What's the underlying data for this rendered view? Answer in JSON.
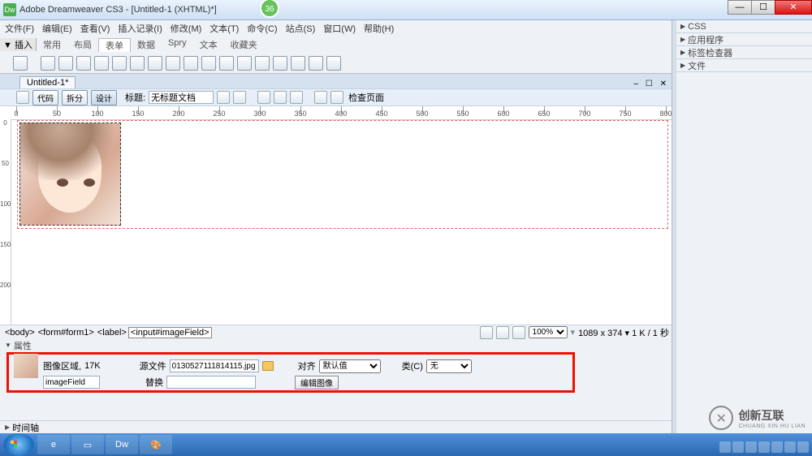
{
  "window": {
    "title": "Adobe Dreamweaver CS3 - [Untitled-1 (XHTML)*]",
    "badge": "36"
  },
  "menus": [
    "文件(F)",
    "编辑(E)",
    "查看(V)",
    "插入记录(I)",
    "修改(M)",
    "文本(T)",
    "命令(C)",
    "站点(S)",
    "窗口(W)",
    "帮助(H)"
  ],
  "insert": {
    "lead": "▼ 插入",
    "tabs": [
      "常用",
      "布局",
      "表单",
      "数据",
      "Spry",
      "文本",
      "收藏夹"
    ],
    "active_index": 2
  },
  "doc_tab": "Untitled-1*",
  "doc_winops": "– ☐ ✕",
  "doc_toolbar": {
    "code_btn": "代码",
    "split_btn": "拆分",
    "design_btn": "设计",
    "title_label": "标题:",
    "title_value": "无标题文档",
    "check_page": "检查页面"
  },
  "ruler_ticks": [
    0,
    50,
    100,
    150,
    200,
    250,
    300,
    350,
    400,
    450,
    500,
    550,
    600,
    650,
    700,
    750,
    800
  ],
  "vruler_ticks": [
    0,
    50,
    100,
    150,
    200
  ],
  "status": {
    "path": [
      "<body>",
      "<form#form1>",
      "<label>",
      "<input#imageField>"
    ],
    "zoom": "100%",
    "dims": "1089 x 374 ▾ 1 K / 1 秒"
  },
  "properties": {
    "header": "属性",
    "region_label": "图像区域,",
    "size": "17K",
    "name_value": "imageField",
    "src_label": "源文件",
    "src_value": "0130527111814115.jpg",
    "alt_label": "替换",
    "alt_value": "",
    "align_label": "对齐",
    "align_value": "默认值",
    "edit_btn": "编辑图像",
    "class_label": "类(C)",
    "class_value": "无"
  },
  "timeline": "时间轴",
  "right_panels": [
    "CSS",
    "应用程序",
    "标签检查器",
    "文件"
  ],
  "brand": {
    "name": "创新互联",
    "pinyin": "CHUANG XIN HU LIAN"
  }
}
